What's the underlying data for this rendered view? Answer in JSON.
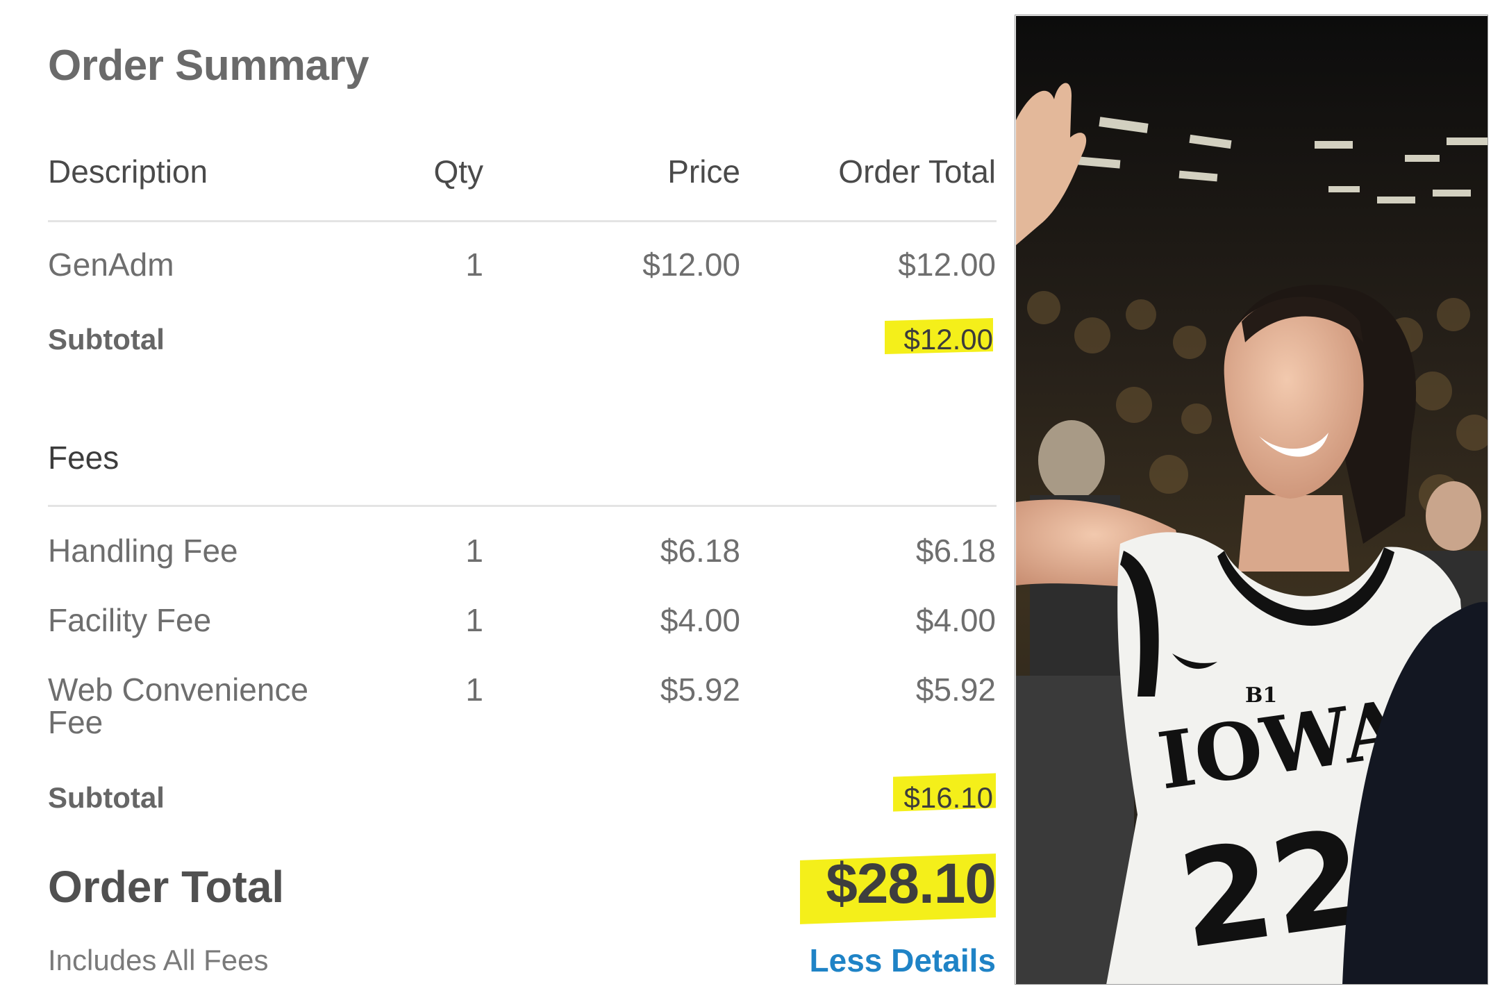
{
  "order_summary": {
    "title": "Order Summary",
    "columns": {
      "description": "Description",
      "qty": "Qty",
      "price": "Price",
      "order_total": "Order Total"
    },
    "items": [
      {
        "description": "GenAdm",
        "qty": "1",
        "price": "$12.00",
        "total": "$12.00"
      }
    ],
    "items_subtotal": {
      "label": "Subtotal",
      "value": "$12.00"
    },
    "fees_heading": "Fees",
    "fees": [
      {
        "description": "Handling Fee",
        "qty": "1",
        "price": "$6.18",
        "total": "$6.18"
      },
      {
        "description": "Facility Fee",
        "qty": "1",
        "price": "$4.00",
        "total": "$4.00"
      },
      {
        "description_line1": "Web Convenience",
        "description_line2": "Fee",
        "qty": "1",
        "price": "$5.92",
        "total": "$5.92"
      }
    ],
    "fees_subtotal": {
      "label": "Subtotal",
      "value": "$16.10"
    },
    "order_total": {
      "label": "Order Total",
      "value": "$28.10"
    },
    "includes_note": "Includes All Fees",
    "less_details_link": "Less Details"
  },
  "photo": {
    "jersey_text": "IOWA",
    "jersey_number": "22",
    "jersey_badge": "B1"
  },
  "colors": {
    "highlight": "#f4ef1a",
    "link": "#1f83c6",
    "jersey": "#f2f2ef",
    "crowd": "#161616"
  }
}
